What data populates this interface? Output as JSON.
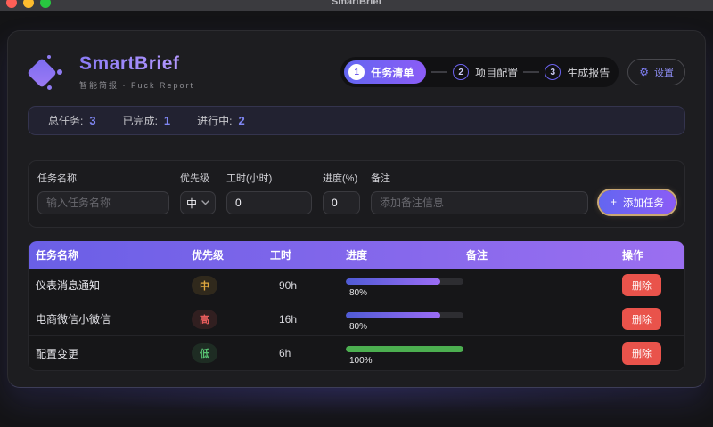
{
  "window": {
    "title": "SmartBrief"
  },
  "header": {
    "app_name": "SmartBrief",
    "app_subtitle": "智能简报 · Fuck Report",
    "steps": [
      {
        "num": "1",
        "label": "任务清单"
      },
      {
        "num": "2",
        "label": "项目配置"
      },
      {
        "num": "3",
        "label": "生成报告"
      }
    ],
    "settings_label": "设置",
    "settings_icon": "⚙"
  },
  "stats": {
    "total": {
      "label": "总任务:",
      "value": "3"
    },
    "done": {
      "label": "已完成:",
      "value": "1"
    },
    "ongoing": {
      "label": "进行中:",
      "value": "2"
    }
  },
  "form": {
    "task_name": {
      "label": "任务名称",
      "placeholder": "输入任务名称",
      "value": ""
    },
    "priority": {
      "label": "优先级",
      "value": "中"
    },
    "hours": {
      "label": "工时(小时)",
      "value": "0"
    },
    "progress": {
      "label": "进度(%)",
      "value": "0"
    },
    "note": {
      "label": "备注",
      "placeholder": "添加备注信息",
      "value": ""
    },
    "add_button": {
      "icon": "+",
      "label": "添加任务"
    }
  },
  "table": {
    "headers": [
      "任务名称",
      "优先级",
      "工时",
      "进度",
      "备注",
      "操作"
    ],
    "rows": [
      {
        "name": "仪表消息通知",
        "priority": "中",
        "priority_level": "medium",
        "hours": "90h",
        "progress": 80,
        "progress_label": "80%",
        "note": "",
        "action": "删除"
      },
      {
        "name": "电商微信小微信",
        "priority": "高",
        "priority_level": "high",
        "hours": "16h",
        "progress": 80,
        "progress_label": "80%",
        "note": "",
        "action": "删除"
      },
      {
        "name": "配置变更",
        "priority": "低",
        "priority_level": "low",
        "hours": "6h",
        "progress": 100,
        "progress_label": "100%",
        "note": "",
        "action": "删除"
      }
    ]
  },
  "colors": {
    "accent_indigo": "#6366f1",
    "accent_violet": "#8b5cf6",
    "stat_number": "#7f86f2",
    "priority_medium": "#e0a83f",
    "priority_high": "#e65c5c",
    "priority_low": "#58c272",
    "progress_done_green": "#4caf50",
    "delete_red": "#e9534b",
    "add_button_ring": "#c9a873",
    "traffic_red": "#ff5f57",
    "traffic_yellow": "#febc2e",
    "traffic_green": "#28c840"
  }
}
